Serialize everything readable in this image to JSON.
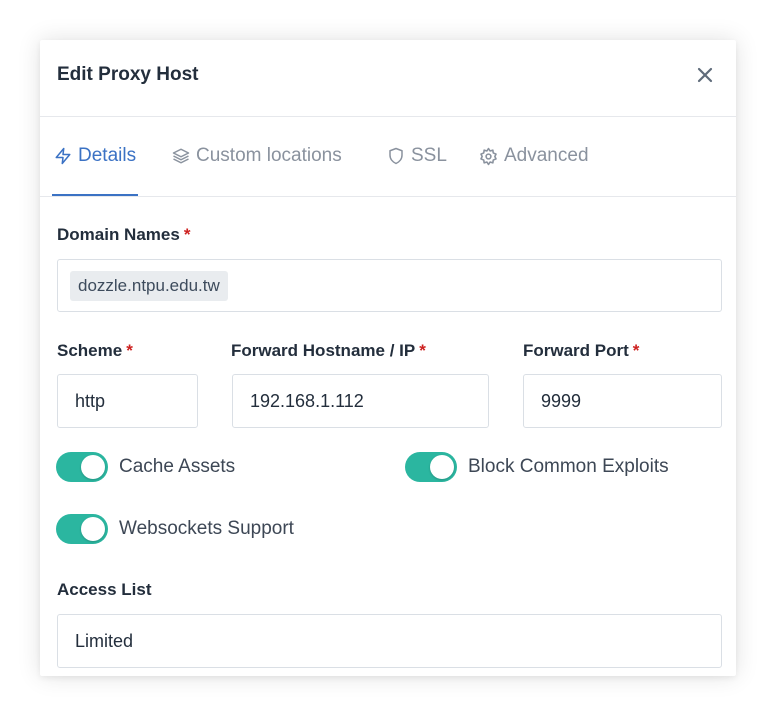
{
  "modal": {
    "title": "Edit Proxy Host"
  },
  "tabs": [
    {
      "label": "Details",
      "icon": "lightning-icon",
      "active": true
    },
    {
      "label": "Custom locations",
      "icon": "layers-icon",
      "active": false
    },
    {
      "label": "SSL",
      "icon": "shield-icon",
      "active": false
    },
    {
      "label": "Advanced",
      "icon": "gear-icon",
      "active": false
    }
  ],
  "form": {
    "domain_names": {
      "label": "Domain Names",
      "required_mark": "*",
      "chips": [
        "dozzle.ntpu.edu.tw"
      ]
    },
    "scheme": {
      "label": "Scheme",
      "required_mark": "*",
      "value": "http"
    },
    "forward_host": {
      "label": "Forward Hostname / IP",
      "required_mark": "*",
      "value": "192.168.1.112"
    },
    "forward_port": {
      "label": "Forward Port",
      "required_mark": "*",
      "value": "9999"
    },
    "cache_assets": {
      "label": "Cache Assets",
      "enabled": true
    },
    "block_exploits": {
      "label": "Block Common Exploits",
      "enabled": true
    },
    "websockets": {
      "label": "Websockets Support",
      "enabled": true
    },
    "access_list": {
      "label": "Access List",
      "value": "Limited"
    }
  },
  "colors": {
    "accent": "#3b72c4",
    "toggle_on": "#2bb6a0",
    "required": "#cd201f"
  }
}
